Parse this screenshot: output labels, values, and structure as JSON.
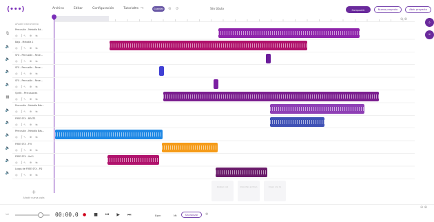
{
  "app": {
    "logo": "(•••)",
    "title": "Sin título",
    "menu": [
      "Archivo",
      "Editar",
      "Configuración",
      "Tutoriales"
    ],
    "undo": "↶",
    "redo": "↷",
    "save_label": "Guardar",
    "history": [
      "⟲",
      "⟳"
    ],
    "share_label": "Compartir",
    "buttons": [
      "Nuevo proyecto",
      "Abrir proyecto"
    ]
  },
  "track_panel": {
    "add_track_head": "Añadir instrumento",
    "tracks": [
      {
        "name": "Percusión - Melodía Bá...",
        "icon": "mic-icon"
      },
      {
        "name": "Bajo - Melodía 1",
        "icon": "speaker-icon"
      },
      {
        "name": "SFX - Percusión - Reve...",
        "icon": "speaker-icon"
      },
      {
        "name": "SFX - Percusión - Reve...",
        "icon": "speaker-icon"
      },
      {
        "name": "SFX - Percusión - Reve...",
        "icon": "speaker-icon"
      },
      {
        "name": "Synth - Percusiones",
        "icon": "keyboard-icon"
      },
      {
        "name": "Percusión - Melodía Bás...",
        "icon": "speaker-icon"
      },
      {
        "name": "FREE SFX - BEATS",
        "icon": "speaker-icon"
      },
      {
        "name": "Percusión - Melodía Bás...",
        "icon": "speaker-icon"
      },
      {
        "name": "FREE SFX - FM",
        "icon": "speaker-icon"
      },
      {
        "name": "FREE SFX - Vol.1",
        "icon": "speaker-icon"
      },
      {
        "name": "Loops de FREE SFX - PD",
        "icon": "speaker-icon"
      }
    ],
    "track_controls": "◎ ʃ∿ ⊕ ⇆",
    "add_track_plus": "+",
    "add_track_label": "Añadir nueva pista"
  },
  "clips": [
    {
      "track": 0,
      "start": 0.454,
      "length": 0.392,
      "color": "#8e24aa"
    },
    {
      "track": 1,
      "start": 0.151,
      "length": 0.551,
      "color": "#b0126c"
    },
    {
      "track": 2,
      "start": 0.586,
      "length": 0.013,
      "color": "#6a1b9a",
      "short": true
    },
    {
      "track": 3,
      "start": 0.29,
      "length": 0.013,
      "color": "#3f3fd4",
      "short": true
    },
    {
      "track": 4,
      "start": 0.441,
      "length": 0.013,
      "color": "#7b1fa2",
      "short": true
    },
    {
      "track": 5,
      "start": 0.3,
      "length": 0.601,
      "color": "#7b1f8f"
    },
    {
      "track": 6,
      "start": 0.598,
      "length": 0.262,
      "color": "#8e3fb5"
    },
    {
      "track": 7,
      "start": 0.598,
      "length": 0.152,
      "color": "#3f51b5"
    },
    {
      "track": 8,
      "start": 0.0,
      "length": 0.298,
      "color": "#1e88e5"
    },
    {
      "track": 9,
      "start": 0.296,
      "length": 0.157,
      "color": "#f59b19"
    },
    {
      "track": 10,
      "start": 0.146,
      "length": 0.144,
      "color": "#b0126c"
    },
    {
      "track": 11,
      "start": 0.446,
      "length": 0.144,
      "color": "#6a1b6a"
    }
  ],
  "empty_tools": [
    "Grabar voz",
    "Importar archivo",
    "Crear con IA"
  ],
  "floating": {
    "top": "⌕",
    "bottom": "∞"
  },
  "zoom_icons": "⊖ ⊕",
  "bottom": {
    "volume_label": "Vol",
    "time": "00:00.0",
    "transport": [
      "●",
      "■",
      "⏮",
      "▶",
      "⏭"
    ],
    "bpm": "Bpm",
    "metronome": "Mt",
    "pill_label": "Sincronizar",
    "extra_icon": "⚙",
    "zoom": "⊖ ⊕"
  }
}
